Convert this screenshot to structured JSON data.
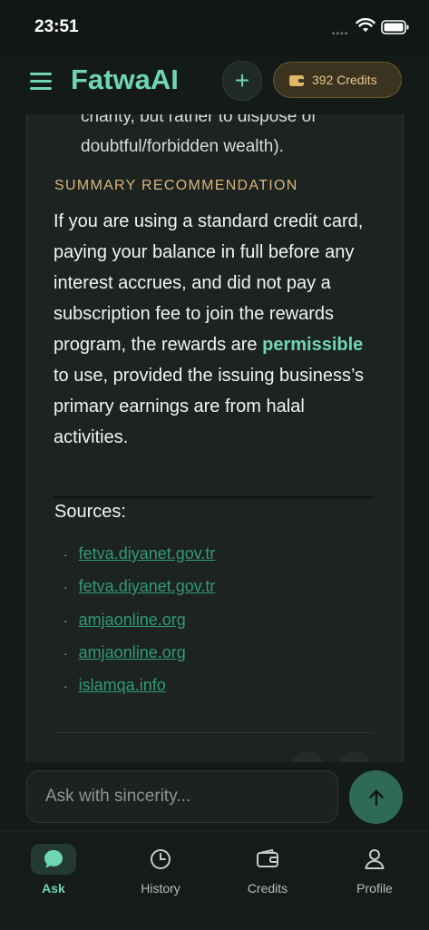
{
  "status": {
    "time": "23:51"
  },
  "header": {
    "title": "FatwaAI",
    "credits_label": "392 Credits"
  },
  "answer": {
    "prev_text": "charity, but rather to dispose of doubtful/forbidden wealth).",
    "summary_heading": "SUMMARY RECOMMENDATION",
    "summary_before": "If you are using a standard credit card, paying your balance in full before any interest accrues, and did not pay a subscription fee to join the rewards program, the rewards are ",
    "summary_highlight": "permissible",
    "summary_after": " to use, provided the issuing business’s primary earnings are from halal activities.",
    "sources_label": "Sources:",
    "sources": [
      "fetva.diyanet.gov.tr",
      "fetva.diyanet.gov.tr",
      "amjaonline.org",
      "amjaonline.org",
      "islamqa.info"
    ]
  },
  "input": {
    "placeholder": "Ask with sincerity..."
  },
  "tabs": [
    {
      "label": "Ask",
      "icon": "chat-bubble-icon",
      "active": true
    },
    {
      "label": "History",
      "icon": "clock-icon",
      "active": false
    },
    {
      "label": "Credits",
      "icon": "wallet-icon",
      "active": false
    },
    {
      "label": "Profile",
      "icon": "person-icon",
      "active": false
    }
  ],
  "colors": {
    "accent": "#6fd6b2",
    "gold": "#d9b57a",
    "link": "#2f9b72",
    "background": "#151a18"
  }
}
